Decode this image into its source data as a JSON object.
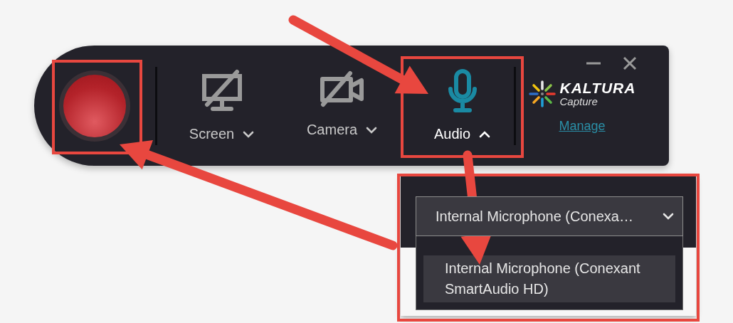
{
  "sources": [
    {
      "label": "Screen",
      "kind": "screen",
      "enabled": false,
      "expanded": false
    },
    {
      "label": "Camera",
      "kind": "camera",
      "enabled": false,
      "expanded": false
    },
    {
      "label": "Audio",
      "kind": "microphone",
      "enabled": true,
      "expanded": true
    }
  ],
  "logo": {
    "brand": "KALTURA",
    "product": "Capture"
  },
  "manage_link": "Manage",
  "audio_panel": {
    "selected_device": "Internal Microphone (Conexa…",
    "options": [
      {
        "label": "Internal Microphone (Conexant SmartAudio HD)",
        "selected": true
      }
    ]
  }
}
